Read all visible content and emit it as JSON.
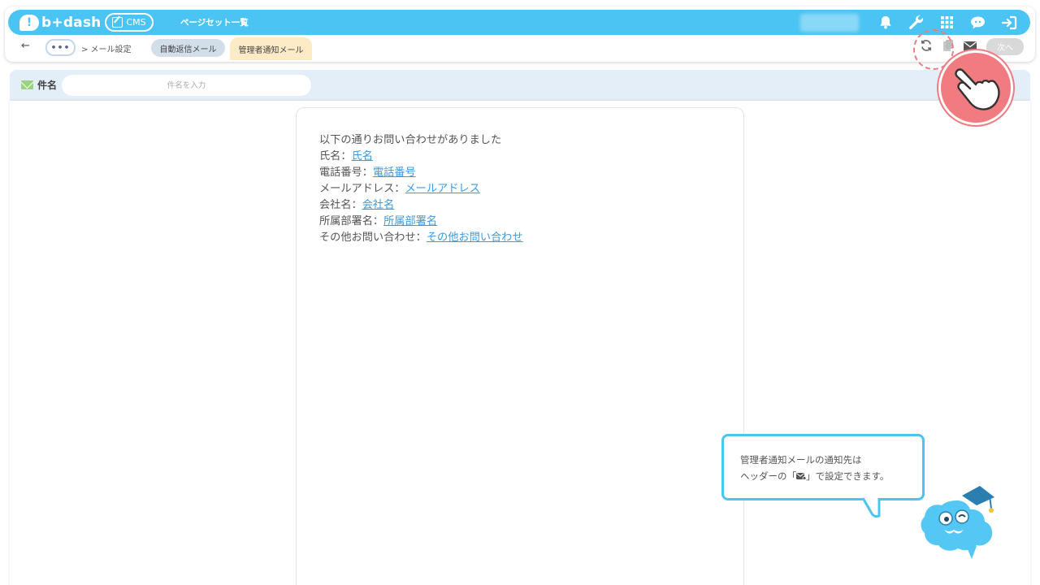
{
  "header": {
    "logo_text": "b+dash",
    "cms_label": "CMS",
    "page_title": "ページセット一覧"
  },
  "subbar": {
    "back_glyph": "←",
    "more_glyph": "•••",
    "breadcrumb": "> メール設定",
    "tab_auto_reply": "自動返信メール",
    "tab_admin_notice": "管理者通知メール",
    "next_label": "次へ"
  },
  "subject": {
    "label": "件名",
    "placeholder": "件名を入力"
  },
  "mail_body": {
    "intro": "以下の通りお問い合わせがありました",
    "fields": [
      {
        "label": "氏名：",
        "value": "氏名"
      },
      {
        "label": "電話番号：",
        "value": "電話番号"
      },
      {
        "label": "メールアドレス：",
        "value": "メールアドレス"
      },
      {
        "label": "会社名：",
        "value": "会社名"
      },
      {
        "label": "所属部署名：",
        "value": "所属部署名"
      },
      {
        "label": "その他お問い合わせ：",
        "value": "その他お問い合わせ"
      }
    ]
  },
  "callout": {
    "line1": "管理者通知メールの通知先は",
    "line2_prefix": "ヘッダーの「",
    "line2_suffix": "」で設定できます。"
  },
  "colors": {
    "brand": "#4cc4f3",
    "highlight": "#f07b80",
    "active_tab": "#fcebc6",
    "link": "#3a9be0"
  }
}
